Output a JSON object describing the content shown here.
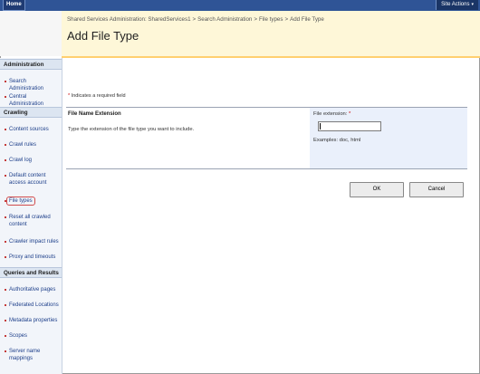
{
  "topbar": {
    "home_tab": "Home",
    "site_actions": "Site Actions",
    "site_actions_arrow": "▾"
  },
  "header": {
    "breadcrumb": [
      "Shared Services Administration: SharedServices1",
      "Search Administration",
      "File types",
      "Add File Type"
    ],
    "breadcrumb_separator": ">",
    "title": "Add File Type"
  },
  "sidebar": {
    "sections": [
      {
        "heading": "Administration",
        "items": [
          "Search Administration",
          "Central Administration"
        ]
      },
      {
        "heading": "Crawling",
        "items": [
          "Content sources",
          "Crawl rules",
          "Crawl log",
          "Default content access account",
          "File types",
          "Reset all crawled content",
          "Crawler impact rules",
          "Proxy and timeouts"
        ]
      },
      {
        "heading": "Queries and Results",
        "items": [
          "Authoritative pages",
          "Federated Locations",
          "Metadata properties",
          "Scopes",
          "Server name mappings"
        ]
      }
    ],
    "active_item": "File types"
  },
  "form": {
    "required_note_star": "*",
    "required_note": "Indicates a required field",
    "section_title": "File Name Extension",
    "section_description": "Type the extension of the file type you want to include.",
    "field_label": "File extension:",
    "field_required_star": "*",
    "field_value": "",
    "examples": "Examples: doc, html",
    "ok_label": "OK",
    "cancel_label": "Cancel"
  },
  "colors": {
    "topbar": "#2f5496",
    "title_background": "#fef7d8",
    "title_underline": "#ffd06f",
    "nav_background": "#f2f5fa",
    "link": "#1d3f8a",
    "required": "#cc0000",
    "field_panel": "#eaf0fb"
  }
}
